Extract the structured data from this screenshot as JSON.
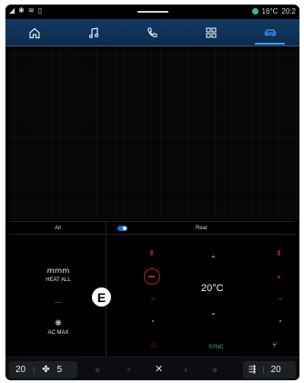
{
  "status": {
    "temperature": "16°C",
    "clock": "20:2"
  },
  "nav": {
    "tabs": [
      {
        "id": "home",
        "icon": "home-icon"
      },
      {
        "id": "music",
        "icon": "music-icon"
      },
      {
        "id": "phone",
        "icon": "phone-icon"
      },
      {
        "id": "apps",
        "icon": "apps-grid-icon"
      },
      {
        "id": "vehicle",
        "icon": "car-icon",
        "active": true
      }
    ]
  },
  "climate": {
    "left_header": "All",
    "right_header": "Rear",
    "heat_all_label": "HEAT ALL",
    "ac_max_label": "AC MAX",
    "temperature": "20°C",
    "sync_label": "SYNC"
  },
  "marker": {
    "label": "E"
  },
  "bottom": {
    "left_temp": "20",
    "fan_level": "5",
    "right_temp": "20"
  },
  "colors": {
    "nav_bg": "#123a63",
    "accent": "#3d9bff",
    "heat_red": "#b3231f",
    "sync_green": "#3fbf8b"
  }
}
